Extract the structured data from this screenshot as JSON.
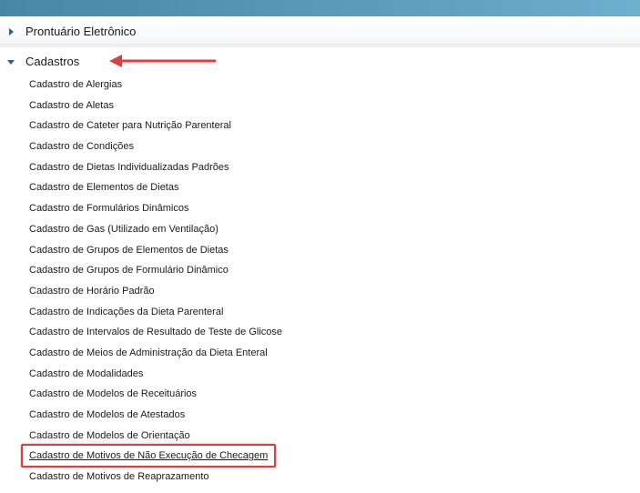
{
  "sections": [
    {
      "label": "Prontuário Eletrônico",
      "expanded": false
    },
    {
      "label": "Cadastros",
      "expanded": true
    }
  ],
  "items": [
    "Cadastro de Alergias",
    "Cadastro de Aletas",
    "Cadastro de Cateter para Nutrição Parenteral",
    "Cadastro de Condições",
    "Cadastro de Dietas Individualizadas Padrões",
    "Cadastro de Elementos de Dietas",
    "Cadastro de Formulários Dinâmicos",
    "Cadastro de Gas (Utilizado em Ventilação)",
    "Cadastro de Grupos de Elementos de Dietas",
    "Cadastro de Grupos de Formulário Dinâmico",
    "Cadastro de Horário Padrão",
    "Cadastro de Indicações da Dieta Parenteral",
    "Cadastro de Intervalos de Resultado de Teste de Glicose",
    "Cadastro de Meios de Administração da Dieta Enteral",
    "Cadastro de Modalidades",
    "Cadastro de Modelos de Receituários",
    "Cadastro de Modelos de Atestados",
    "Cadastro de Modelos de Orientação",
    "Cadastro de Motivos de Não Execução de Checagem",
    "Cadastro de Motivos de Reaprazamento"
  ],
  "selected_item": "Cadastro de Motivos de Não Execução de Checagem",
  "colors": {
    "topbar": "#5b98b9",
    "annotation": "#e23b3b",
    "triangle": "#2d5f86"
  }
}
